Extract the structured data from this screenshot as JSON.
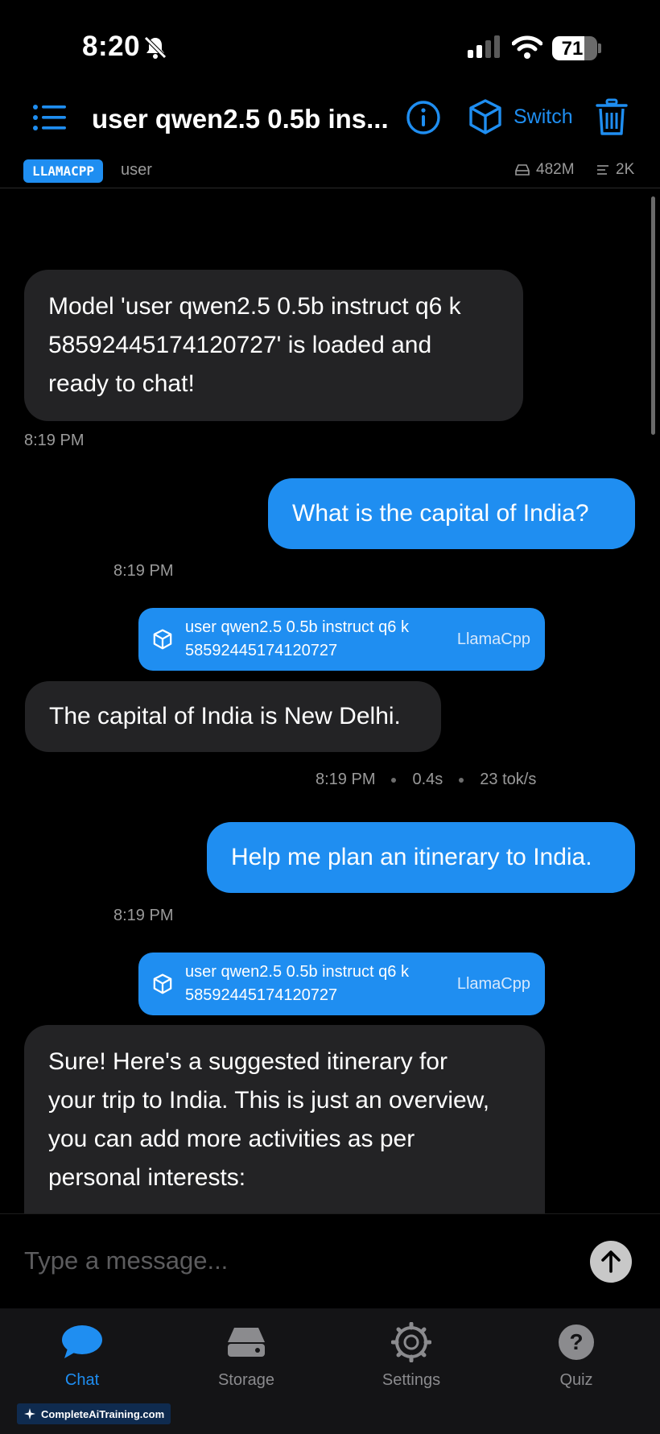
{
  "status_bar": {
    "time": "8:20",
    "battery": "71",
    "battery_level": 0.71
  },
  "header": {
    "title": "user qwen2.5 0.5b ins...",
    "switch_label": "Switch"
  },
  "info_strip": {
    "engine": "LLAMACPP",
    "user": "user",
    "memory": "482M",
    "context": "2K"
  },
  "messages": {
    "m1": {
      "lines": [
        "Model 'user qwen2.5 0.5b instruct q6 k",
        "58592445174120727' is loaded and",
        "ready to chat!"
      ],
      "time": "8:19 PM"
    },
    "m2": {
      "text": "What is the capital of India?",
      "time": "8:19 PM"
    },
    "card1": {
      "model_line1": "user qwen2.5 0.5b instruct q6 k",
      "model_line2": "58592445174120727",
      "engine": "LlamaCpp"
    },
    "m3": {
      "text": "The capital of India is New Delhi.",
      "time": "8:19 PM",
      "duration": "0.4s",
      "speed": "23 tok/s"
    },
    "m4": {
      "text": "Help me plan an itinerary to India.",
      "time": "8:19 PM"
    },
    "card2": {
      "model_line1": "user qwen2.5 0.5b instruct q6 k",
      "model_line2": "58592445174120727",
      "engine": "LlamaCpp"
    },
    "m5": {
      "lines": [
        "Sure! Here's a suggested itinerary for",
        "your trip to India. This is just an overview,",
        "you can add more activities as per",
        "personal interests:"
      ]
    }
  },
  "input": {
    "placeholder": "Type a message..."
  },
  "tabs": [
    {
      "label": "Chat",
      "icon": "chat-bubble-icon",
      "active": true
    },
    {
      "label": "Storage",
      "icon": "drive-icon",
      "active": false
    },
    {
      "label": "Settings",
      "icon": "gear-icon",
      "active": false
    },
    {
      "label": "Quiz",
      "icon": "question-icon",
      "active": false
    }
  ],
  "watermark": "CompleteAiTraining.com",
  "colors": {
    "accent": "#1f8ef1",
    "ai_bubble": "#232325",
    "background": "#000000",
    "tab_bar": "#141416"
  }
}
